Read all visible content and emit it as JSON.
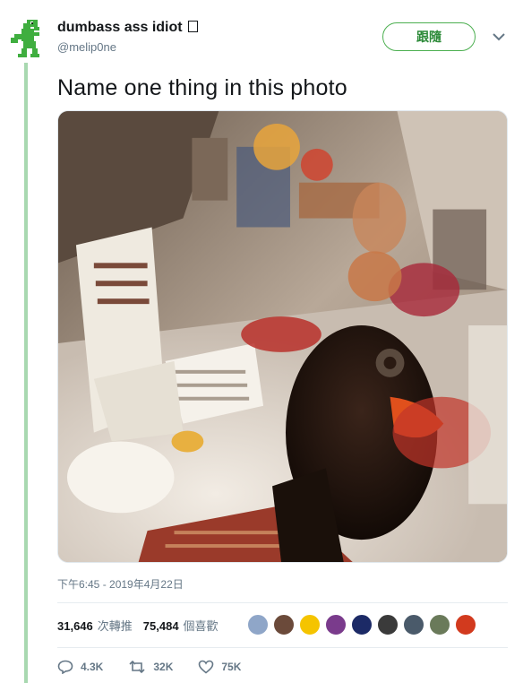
{
  "header": {
    "display_name": "dumbass ass idiot",
    "handle": "@melip0ne",
    "follow_label": "跟隨"
  },
  "tweet": {
    "text": "Name one thing in this photo",
    "timestamp": "下午6:45 - 2019年4月22日"
  },
  "stats": {
    "retweets_count": "31,646",
    "retweets_label": "次轉推",
    "likes_count": "75,484",
    "likes_label": "個喜歡"
  },
  "likers": [
    {
      "icon": "avatar-1",
      "color": "#8fa6c8"
    },
    {
      "icon": "avatar-2",
      "color": "#6b4a3a"
    },
    {
      "icon": "avatar-3",
      "color": "#f5c400"
    },
    {
      "icon": "avatar-4",
      "color": "#7a3b8c"
    },
    {
      "icon": "avatar-5",
      "color": "#1c2a66"
    },
    {
      "icon": "avatar-6",
      "color": "#3a3a3a"
    },
    {
      "icon": "avatar-7",
      "color": "#4a5a6a"
    },
    {
      "icon": "avatar-8",
      "color": "#6a7a5a"
    },
    {
      "icon": "avatar-9",
      "color": "#d23a1e"
    }
  ],
  "actions": {
    "replies": "4.3K",
    "retweets": "32K",
    "likes": "75K"
  },
  "colors": {
    "accent_green": "#2e8b3a",
    "thread_line": "#a8d8b0",
    "muted": "#657786"
  }
}
